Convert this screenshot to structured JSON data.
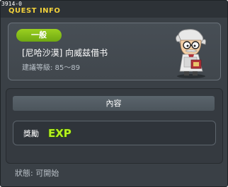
{
  "window": {
    "quest_id": "3914-0",
    "title": "QUEST INFO"
  },
  "quest": {
    "category_badge": "一般",
    "name": "[尼哈沙漠] 向威兹借书",
    "level_range": "建議等級: 85～89"
  },
  "npc": {
    "icon": "old-man-npc-icon"
  },
  "content": {
    "header": "內容",
    "reward_label": "獎勵",
    "reward_icon_text": "EXP"
  },
  "status": {
    "text": "狀態: 可開始"
  },
  "colors": {
    "title": "#f2d13b",
    "badge": "#8bc21a",
    "exp": "#b6f020"
  }
}
